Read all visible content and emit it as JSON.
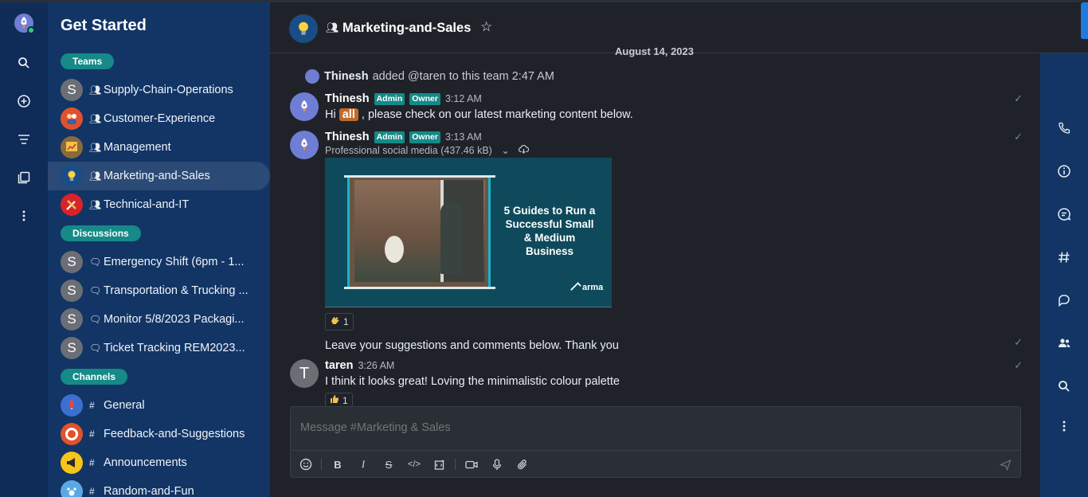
{
  "sidebar": {
    "title": "Get Started",
    "sections": {
      "teams": "Teams",
      "discussions": "Discussions",
      "channels": "Channels"
    },
    "teams": [
      {
        "label": "Supply-Chain-Operations",
        "avatar": "S"
      },
      {
        "label": "Customer-Experience",
        "avatar": ""
      },
      {
        "label": "Management",
        "avatar": ""
      },
      {
        "label": "Marketing-and-Sales",
        "avatar": "",
        "active": true
      },
      {
        "label": "Technical-and-IT",
        "avatar": ""
      }
    ],
    "discussions": [
      {
        "label": "Emergency Shift (6pm - 1...",
        "avatar": "S"
      },
      {
        "label": "Transportation & Trucking ...",
        "avatar": "S"
      },
      {
        "label": "Monitor 5/8/2023 Packagi...",
        "avatar": "S"
      },
      {
        "label": "Ticket Tracking REM2023...",
        "avatar": "S"
      }
    ],
    "channels": [
      {
        "label": "General"
      },
      {
        "label": "Feedback-and-Suggestions"
      },
      {
        "label": "Announcements"
      },
      {
        "label": "Random-and-Fun"
      }
    ]
  },
  "header": {
    "title": "Marketing-and-Sales"
  },
  "date_divider": "August 14, 2023",
  "system_message": {
    "user": "Thinesh",
    "text": "added @taren to this team",
    "time": "2:47 AM"
  },
  "messages": [
    {
      "user": "Thinesh",
      "tags": [
        "Admin",
        "Owner"
      ],
      "time": "3:12 AM",
      "text_before": "Hi",
      "mention": "all",
      "text_after": ", please check on our latest marketing content below."
    },
    {
      "user": "Thinesh",
      "tags": [
        "Admin",
        "Owner"
      ],
      "time": "3:13 AM",
      "attachment": "Professional social media (437.46 kB)",
      "image_text": "5 Guides to Run a Successful Small & Medium Business",
      "image_brand": "arma",
      "reaction_count": "1",
      "follow_text": "Leave your suggestions and comments below. Thank you"
    },
    {
      "user": "taren",
      "avatar": "T",
      "time": "3:26 AM",
      "text": "I think it looks great! Loving the minimalistic colour palette",
      "reaction_count": "1"
    }
  ],
  "composer": {
    "placeholder": "Message #Marketing & Sales"
  },
  "colors": {
    "rail": "#0f2b57",
    "sidebar": "#123566",
    "main_bg": "#1f2329",
    "accent_teal": "#158a87",
    "mention": "#c06a2b"
  },
  "icons": {
    "rail": [
      "avatar",
      "search-icon",
      "create-new-icon",
      "sort-icon",
      "directory-icon",
      "kebab-menu-icon"
    ],
    "right_panel": [
      "call-icon",
      "info-icon",
      "threads-icon",
      "channels-icon",
      "discussions-icon",
      "members-icon",
      "search-icon",
      "kebab-menu-icon"
    ],
    "composer": [
      "emoji-icon",
      "bold-icon",
      "italic-icon",
      "strike-icon",
      "code-icon",
      "code-block-icon",
      "video-icon",
      "mic-icon",
      "attach-icon",
      "send-icon"
    ]
  }
}
